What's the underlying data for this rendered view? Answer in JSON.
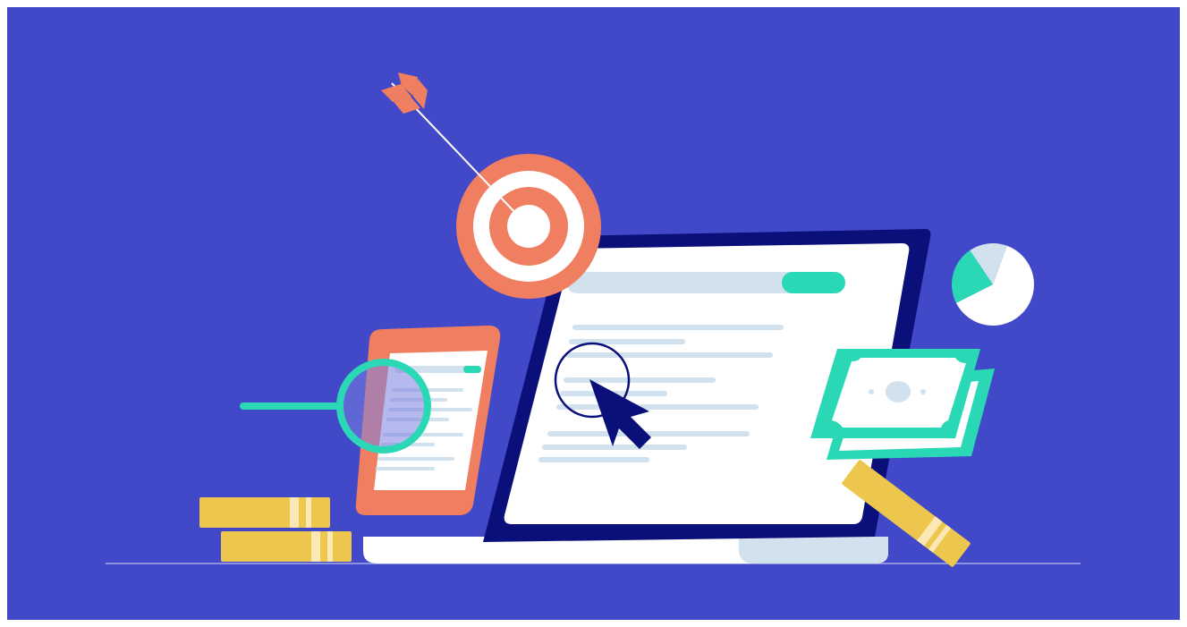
{
  "illustration": {
    "colors": {
      "background": "#4249C8",
      "laptop_frame": "#0B0F7A",
      "screen": "#FFFFFF",
      "text_line": "#D2E1EE",
      "accent_green": "#2AD8B6",
      "coral": "#F07F62",
      "gold": "#EDC74D",
      "gold_stripe": "#FBE8B4",
      "cursor": "#0B0F7A",
      "floor_line": "#8D92E0"
    },
    "icons": [
      "target-icon",
      "arrow-icon",
      "laptop-icon",
      "cursor-icon",
      "smartphone-icon",
      "magnifier-icon",
      "pie-chart-icon",
      "banknotes-icon",
      "coin-stack-icon",
      "gold-bar-icon"
    ],
    "pie_chart": {
      "slices": [
        0.62,
        0.23,
        0.15
      ]
    }
  }
}
